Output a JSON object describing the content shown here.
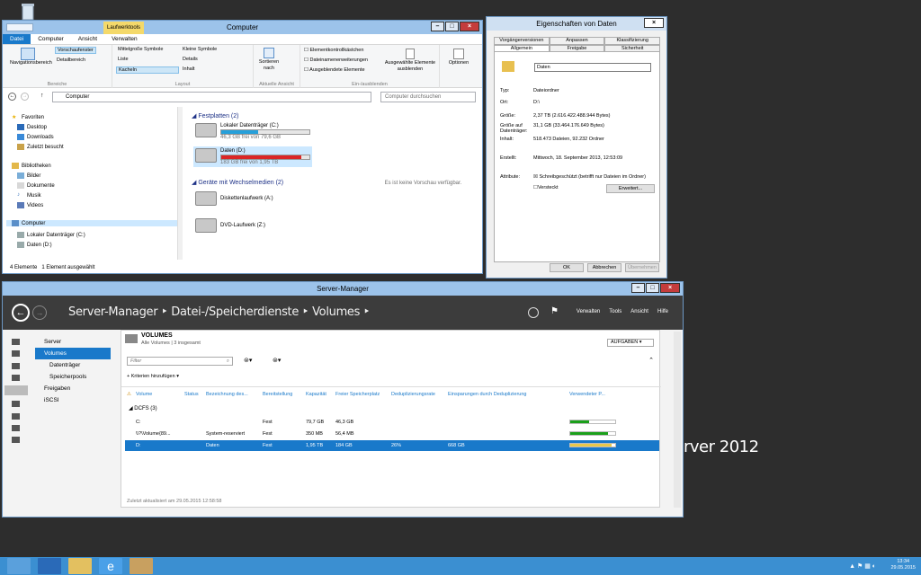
{
  "desktop": {
    "brand": "rver 2012"
  },
  "explorer": {
    "context_tab": "Laufwerktools",
    "title": "Computer",
    "tabs": [
      "Datei",
      "Computer",
      "Ansicht",
      "Verwalten"
    ],
    "ribbon": {
      "nav_pane": "Navigationsbereich",
      "preview": "Vorschaufenster",
      "details_pane": "Detailbereich",
      "group_bereiche": "Bereiche",
      "mid_icons": "Mittelgroße Symbole",
      "small_icons": "Kleine Symbole",
      "list": "Liste",
      "details": "Details",
      "tiles": "Kacheln",
      "content": "Inhalt",
      "group_layout": "Layout",
      "sort": "Sortieren nach",
      "group_current": "Aktuelle Ansicht",
      "checkboxes": "Elementkontrollkästchen",
      "extensions": "Dateinamenerweiterungen",
      "hidden": "Ausgeblendete Elemente",
      "hide_selected": "Ausgewählte Elemente ausblenden",
      "group_show": "Ein-/ausblenden",
      "options": "Optionen"
    },
    "address": "Computer",
    "search_placeholder": "Computer durchsuchen",
    "nav": {
      "favorites": "Favoriten",
      "desktop": "Desktop",
      "downloads": "Downloads",
      "recent": "Zuletzt besucht",
      "libraries": "Bibliotheken",
      "pictures": "Bilder",
      "documents": "Dokumente",
      "music": "Musik",
      "videos": "Videos",
      "computer": "Computer",
      "local_c": "Lokaler Datenträger (C:)",
      "data_d": "Daten (D:)"
    },
    "hdd_group": "Festplatten (2)",
    "drive_c": {
      "name": "Lokaler Datenträger (C:)",
      "free": "46,3 GB frei von 79,6 GB",
      "used": 0.42,
      "color": "#26a0da"
    },
    "drive_d": {
      "name": "Daten (D:)",
      "free": "183 GB frei von 1,95 TB",
      "used": 0.91,
      "color": "#da2626"
    },
    "removable_group": "Geräte mit Wechselmedien (2)",
    "floppy": "Diskettenlaufwerk (A:)",
    "dvd": "DVD-Laufwerk (Z:)",
    "no_preview": "Es ist keine Vorschau verfügbar.",
    "status_count": "4 Elemente",
    "status_selected": "1 Element ausgewählt"
  },
  "props": {
    "title": "Eigenschaften von Daten",
    "tabs_row1": [
      "Vorgängerversionen",
      "Anpassen",
      "Klassifizierung"
    ],
    "tabs_row2": [
      "Allgemein",
      "Freigabe",
      "Sicherheit"
    ],
    "name": "Daten",
    "type_k": "Typ:",
    "type_v": "Dateiordner",
    "loc_k": "Ort:",
    "loc_v": "D:\\",
    "size_k": "Größe:",
    "size_v": "2,37 TB (2.616.422.488.944 Bytes)",
    "disk_k": "Größe auf Datenträger:",
    "disk_v": "31,1 GB (33.464.176.649 Bytes)",
    "content_k": "Inhalt:",
    "content_v": "518.473 Dateien, 92.232 Ordner",
    "created_k": "Erstellt:",
    "created_v": "Mittwoch, 18. September 2013, 12:53:09",
    "attr_k": "Attribute:",
    "readonly": "Schreibgeschützt (betrifft nur Dateien im Ordner)",
    "hidden": "Versteckt",
    "advanced": "Erweitert...",
    "ok": "OK",
    "cancel": "Abbrechen",
    "apply": "Übernehmen"
  },
  "sm": {
    "title": "Server-Manager",
    "crumb": "Server-Manager ‣ Datei-/Speicherdienste ‣ Volumes ‣",
    "menu": [
      "Verwalten",
      "Tools",
      "Ansicht",
      "Hilfe"
    ],
    "nav": [
      "Server",
      "Volumes",
      "Datenträger",
      "Speicherpools",
      "Freigaben",
      "iSCSI"
    ],
    "heading": "VOLUMES",
    "subheading": "Alle Volumes | 3 insgesamt",
    "tasks": "AUFGABEN",
    "filter_placeholder": "Filter",
    "criteria": "Kriterien hinzufügen",
    "columns": [
      "Volume",
      "Status",
      "Bezeichnung des...",
      "Bereitstellung",
      "Kapazität",
      "Freier Speicherplatz",
      "Deduplizierungsrate",
      "Einsparungen durch Deduplizierung",
      "Verwendeter P..."
    ],
    "group": "DCFS (3)",
    "rows": [
      {
        "volume": "C:",
        "status": "",
        "label": "",
        "prov": "Fest",
        "cap": "79,7 GB",
        "free": "46,3 GB",
        "rate": "",
        "save": "",
        "used": 0.42,
        "color": "#1aa01a"
      },
      {
        "volume": "\\\\?\\Volume{89...",
        "status": "",
        "label": "System-reserviert",
        "prov": "Fest",
        "cap": "350 MB",
        "free": "56,4 MB",
        "rate": "",
        "save": "",
        "used": 0.84,
        "color": "#1aa01a"
      },
      {
        "volume": "D:",
        "status": "",
        "label": "Daten",
        "prov": "Fest",
        "cap": "1,95 TB",
        "free": "184 GB",
        "rate": "26%",
        "save": "668 GB",
        "used": 0.91,
        "color": "#e8c84a"
      }
    ],
    "footer": "Zuletzt aktualisiert am 29.05.2015 12:58:58"
  },
  "taskbar": {
    "time": "13:34",
    "date": "29.05.2015"
  }
}
